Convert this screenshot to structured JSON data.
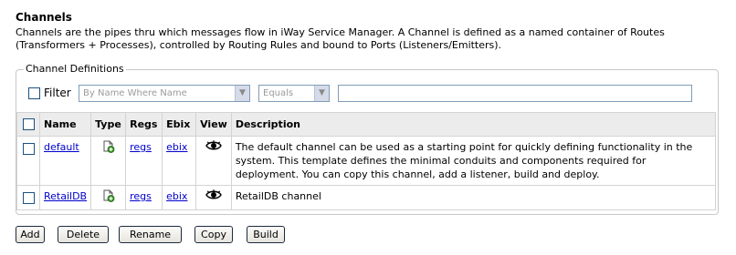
{
  "header": {
    "title": "Channels",
    "description": "Channels are the pipes thru which messages flow in iWay Service Manager. A Channel is defined as a named container of Routes (Transformers + Processes), controlled by Routing Rules and bound to Ports (Listeners/Emitters)."
  },
  "definitions": {
    "legend": "Channel Definitions",
    "filter": {
      "label": "Filter",
      "checked": false,
      "field_select": "By Name Where Name",
      "operator_select": "Equals",
      "value": ""
    },
    "columns": [
      "Name",
      "Type",
      "Regs",
      "Ebix",
      "View",
      "Description"
    ],
    "rows": [
      {
        "name": "default",
        "type_icon": "channel-type-icon",
        "regs": "regs",
        "ebix": "ebix",
        "view_icon": "eye-icon",
        "description": "The default channel can be used as a starting point for quickly defining functionality in the system. This template defines the minimal conduits and components required for deployment. You can copy this channel, add a listener, build and deploy."
      },
      {
        "name": "RetailDB",
        "type_icon": "channel-type-icon",
        "regs": "regs",
        "ebix": "ebix",
        "view_icon": "eye-icon",
        "description": "RetailDB channel"
      }
    ]
  },
  "buttons": {
    "add": "Add",
    "delete": "Delete",
    "rename": "Rename",
    "copy": "Copy",
    "build": "Build"
  },
  "colors": {
    "link": "#0000cc",
    "header_bg": "#ececec",
    "checkbox_border": "#1c5180"
  }
}
